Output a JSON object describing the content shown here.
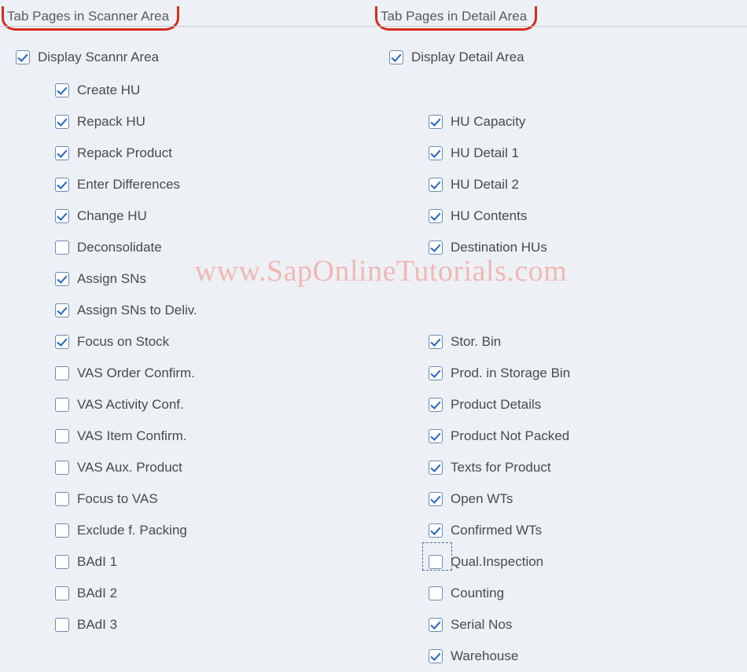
{
  "watermark": "www.SapOnlineTutorials.com",
  "left": {
    "header": "Tab Pages in Scanner Area",
    "top": {
      "label": "Display Scannr Area",
      "checked": true
    },
    "items": [
      {
        "label": "Create HU",
        "checked": true
      },
      {
        "label": "Repack HU",
        "checked": true
      },
      {
        "label": "Repack Product",
        "checked": true
      },
      {
        "label": "Enter Differences",
        "checked": true
      },
      {
        "label": "Change HU",
        "checked": true
      },
      {
        "label": "Deconsolidate",
        "checked": false
      },
      {
        "label": "Assign SNs",
        "checked": true
      },
      {
        "label": "Assign SNs to Deliv.",
        "checked": true
      },
      {
        "label": "Focus on Stock",
        "checked": true
      },
      {
        "label": "VAS Order Confirm.",
        "checked": false
      },
      {
        "label": "VAS Activity Conf.",
        "checked": false
      },
      {
        "label": "VAS Item Confirm.",
        "checked": false
      },
      {
        "label": "VAS Aux. Product",
        "checked": false
      },
      {
        "label": "Focus to VAS",
        "checked": false
      },
      {
        "label": "Exclude f. Packing",
        "checked": false
      },
      {
        "label": "BAdI 1",
        "checked": false
      },
      {
        "label": "BAdI 2",
        "checked": false
      },
      {
        "label": "BAdI 3",
        "checked": false
      }
    ]
  },
  "right": {
    "header": "Tab Pages in Detail Area",
    "top": {
      "label": "Display Detail Area",
      "checked": true
    },
    "group1": [
      {
        "label": "HU Capacity",
        "checked": true
      },
      {
        "label": "HU Detail 1",
        "checked": true
      },
      {
        "label": "HU Detail 2",
        "checked": true
      },
      {
        "label": "HU Contents",
        "checked": true
      },
      {
        "label": "Destination HUs",
        "checked": true
      }
    ],
    "group2": [
      {
        "label": "Stor. Bin",
        "checked": true
      },
      {
        "label": "Prod. in Storage Bin",
        "checked": true
      },
      {
        "label": "Product Details",
        "checked": true
      },
      {
        "label": "Product Not Packed",
        "checked": true
      },
      {
        "label": "Texts for Product",
        "checked": true
      },
      {
        "label": "Open WTs",
        "checked": true
      },
      {
        "label": "Confirmed WTs",
        "checked": true
      },
      {
        "label": "Qual.Inspection",
        "checked": false,
        "focus": true
      },
      {
        "label": "Counting",
        "checked": false
      },
      {
        "label": "Serial Nos",
        "checked": true
      },
      {
        "label": "Warehouse",
        "checked": true
      }
    ]
  }
}
